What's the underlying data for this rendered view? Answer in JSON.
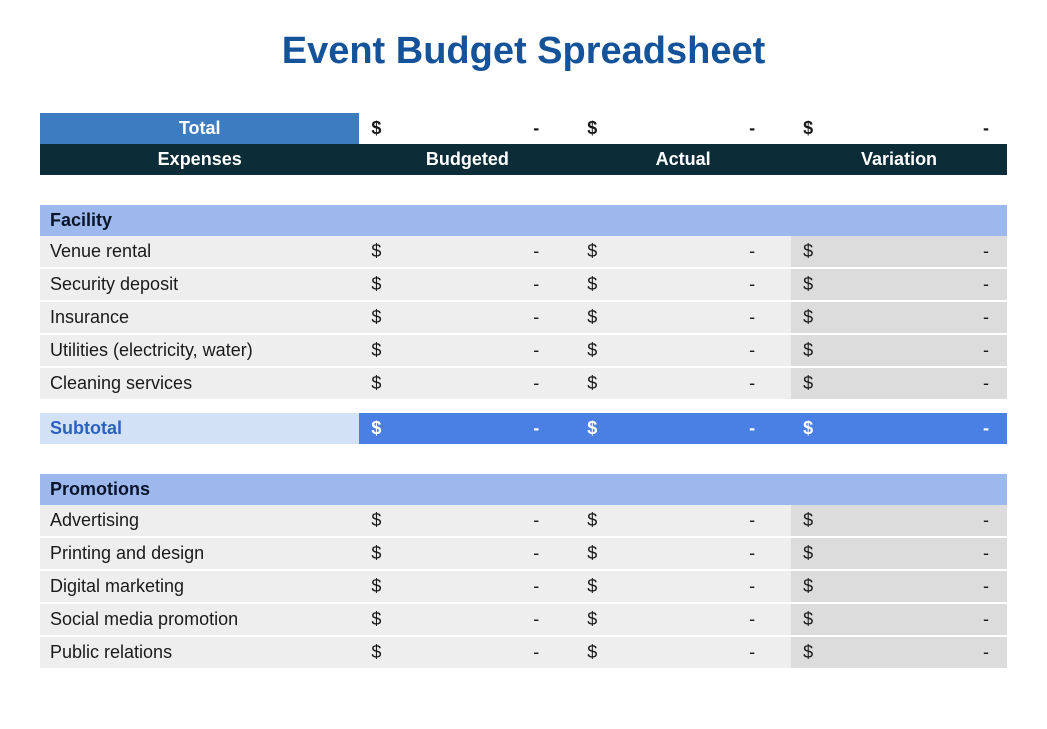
{
  "title": "Event Budget Spreadsheet",
  "totalLabel": "Total",
  "headers": {
    "expenses": "Expenses",
    "budgeted": "Budgeted",
    "actual": "Actual",
    "variation": "Variation"
  },
  "currency": "$",
  "empty": "-",
  "totals": {
    "budgeted": "-",
    "actual": "-",
    "variation": "-"
  },
  "subtotalLabel": "Subtotal",
  "sections": [
    {
      "name": "Facility",
      "rows": [
        {
          "label": "Venue rental",
          "budgeted": "-",
          "actual": "-",
          "variation": "-"
        },
        {
          "label": "Security deposit",
          "budgeted": "-",
          "actual": "-",
          "variation": "-"
        },
        {
          "label": "Insurance",
          "budgeted": "-",
          "actual": "-",
          "variation": "-"
        },
        {
          "label": "Utilities (electricity, water)",
          "budgeted": "-",
          "actual": "-",
          "variation": "-"
        },
        {
          "label": "Cleaning services",
          "budgeted": "-",
          "actual": "-",
          "variation": "-"
        }
      ],
      "subtotal": {
        "budgeted": "-",
        "actual": "-",
        "variation": "-"
      }
    },
    {
      "name": "Promotions",
      "rows": [
        {
          "label": "Advertising",
          "budgeted": "-",
          "actual": "-",
          "variation": "-"
        },
        {
          "label": "Printing and design",
          "budgeted": "-",
          "actual": "-",
          "variation": "-"
        },
        {
          "label": "Digital marketing",
          "budgeted": "-",
          "actual": "-",
          "variation": "-"
        },
        {
          "label": "Social media promotion",
          "budgeted": "-",
          "actual": "-",
          "variation": "-"
        },
        {
          "label": "Public relations",
          "budgeted": "-",
          "actual": "-",
          "variation": "-"
        }
      ]
    }
  ]
}
